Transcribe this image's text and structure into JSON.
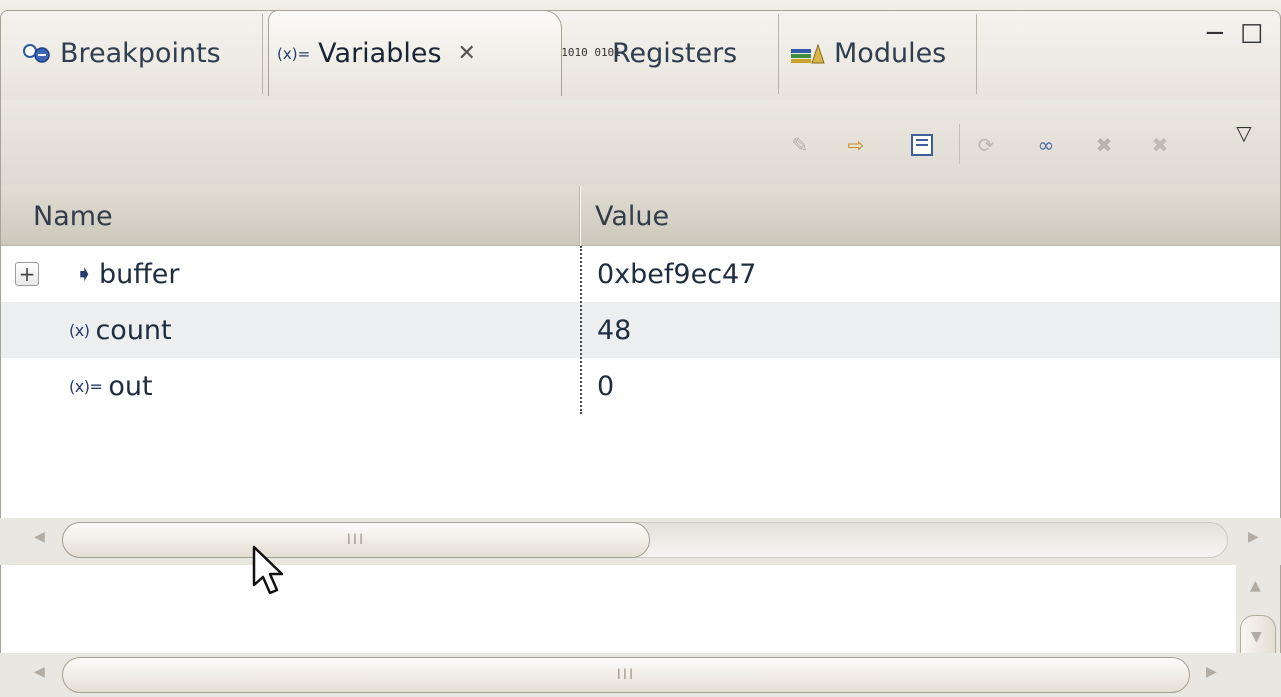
{
  "tabs": [
    {
      "label": "Breakpoints",
      "icon": "breakpoints-icon"
    },
    {
      "label": "Variables",
      "icon": "variables-icon",
      "active": true
    },
    {
      "label": "Registers",
      "icon": "registers-icon"
    },
    {
      "label": "Modules",
      "icon": "modules-icon"
    }
  ],
  "columns": {
    "name": "Name",
    "value": "Value"
  },
  "rows": [
    {
      "name": "buffer",
      "value": "0xbef9ec47",
      "expandable": true,
      "expander": "+",
      "icon": "pointer-variable-icon"
    },
    {
      "name": "count",
      "value": "48",
      "icon": "local-variable-icon"
    },
    {
      "name": "out",
      "value": "0",
      "icon": "variable-icon"
    }
  ],
  "icons": {
    "breakpoints_glyph": "●",
    "variables_glyph": "(x)=",
    "registers_glyph": "1010 0101",
    "pointer_glyph": "➧",
    "count_glyph": "(x)",
    "out_glyph": "(x)=",
    "minimize_glyph": "−",
    "maximize_glyph": "☐",
    "view_menu_glyph": "▽",
    "close_glyph": "✕",
    "h_scroll_grip": "III",
    "scroll_left": "◀",
    "scroll_right": "▶",
    "scroll_up": "▲",
    "scroll_down": "▼"
  },
  "colors": {
    "accent": "#2a4b8d",
    "row_alt": "#eceeef",
    "tab_bg": "#e4e0d8"
  },
  "toolbar_buttons": [
    "show-type-names-icon",
    "show-logical-structure-icon",
    "collapse-all-icon",
    "refresh-icon",
    "add-global-variables-icon",
    "remove-global-variables-icon",
    "remove-all-global-variables-icon"
  ]
}
